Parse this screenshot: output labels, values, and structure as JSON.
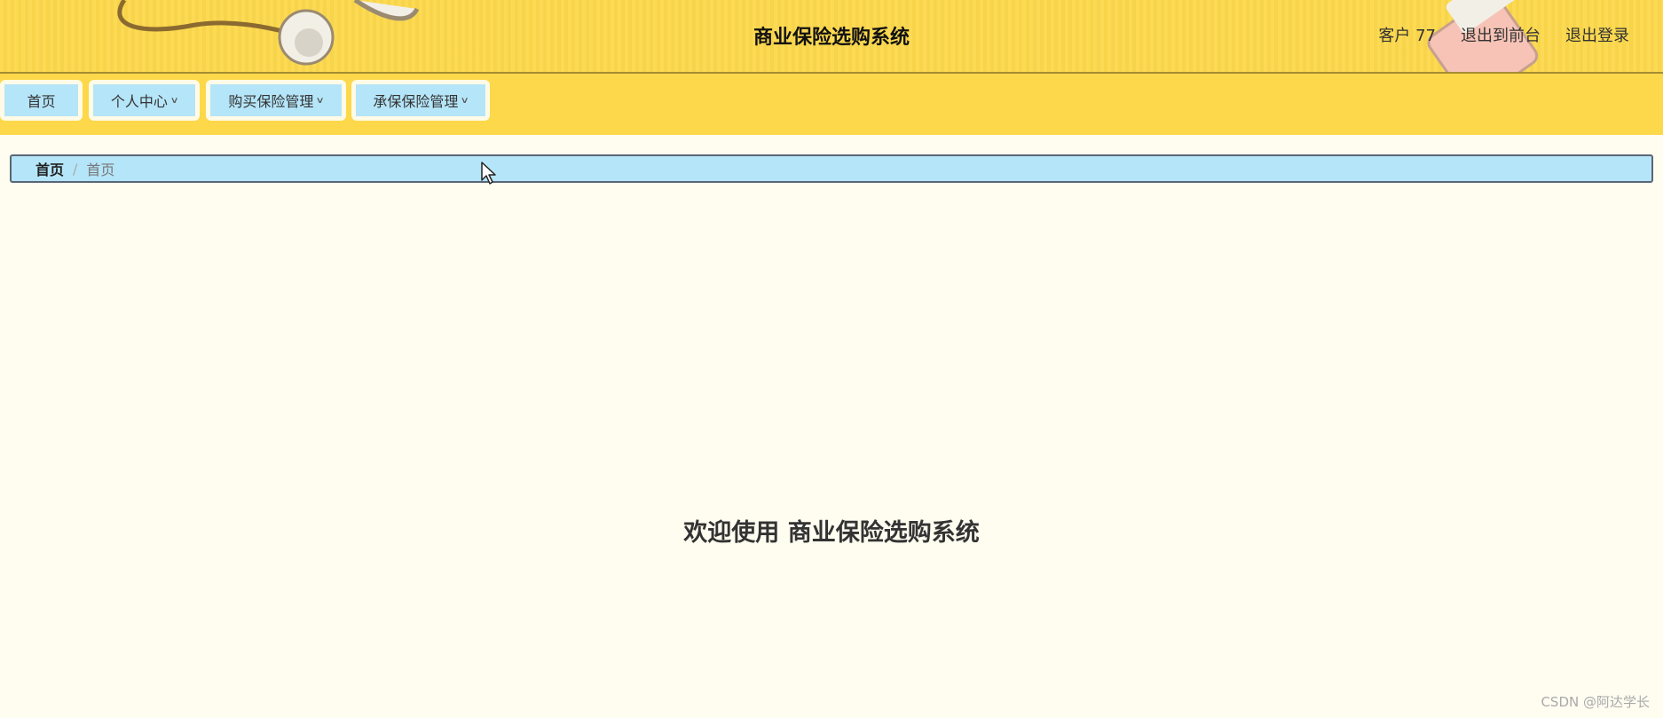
{
  "header": {
    "title": "商业保险选购系统",
    "user_label": "客户 77",
    "front_link": "退出到前台",
    "logout_link": "退出登录"
  },
  "nav": {
    "items": [
      {
        "label": "首页"
      },
      {
        "label": "个人中心"
      },
      {
        "label": "购买保险管理"
      },
      {
        "label": "承保保险管理"
      }
    ]
  },
  "breadcrumb": {
    "home": "首页",
    "separator": "/",
    "current": "首页"
  },
  "main": {
    "welcome": "欢迎使用 商业保险选购系统"
  },
  "watermark": "CSDN @阿达学长",
  "colors": {
    "header_bg": "#fcd84a",
    "nav_item_bg": "#b5e5f8",
    "page_bg": "#fffcf0"
  }
}
